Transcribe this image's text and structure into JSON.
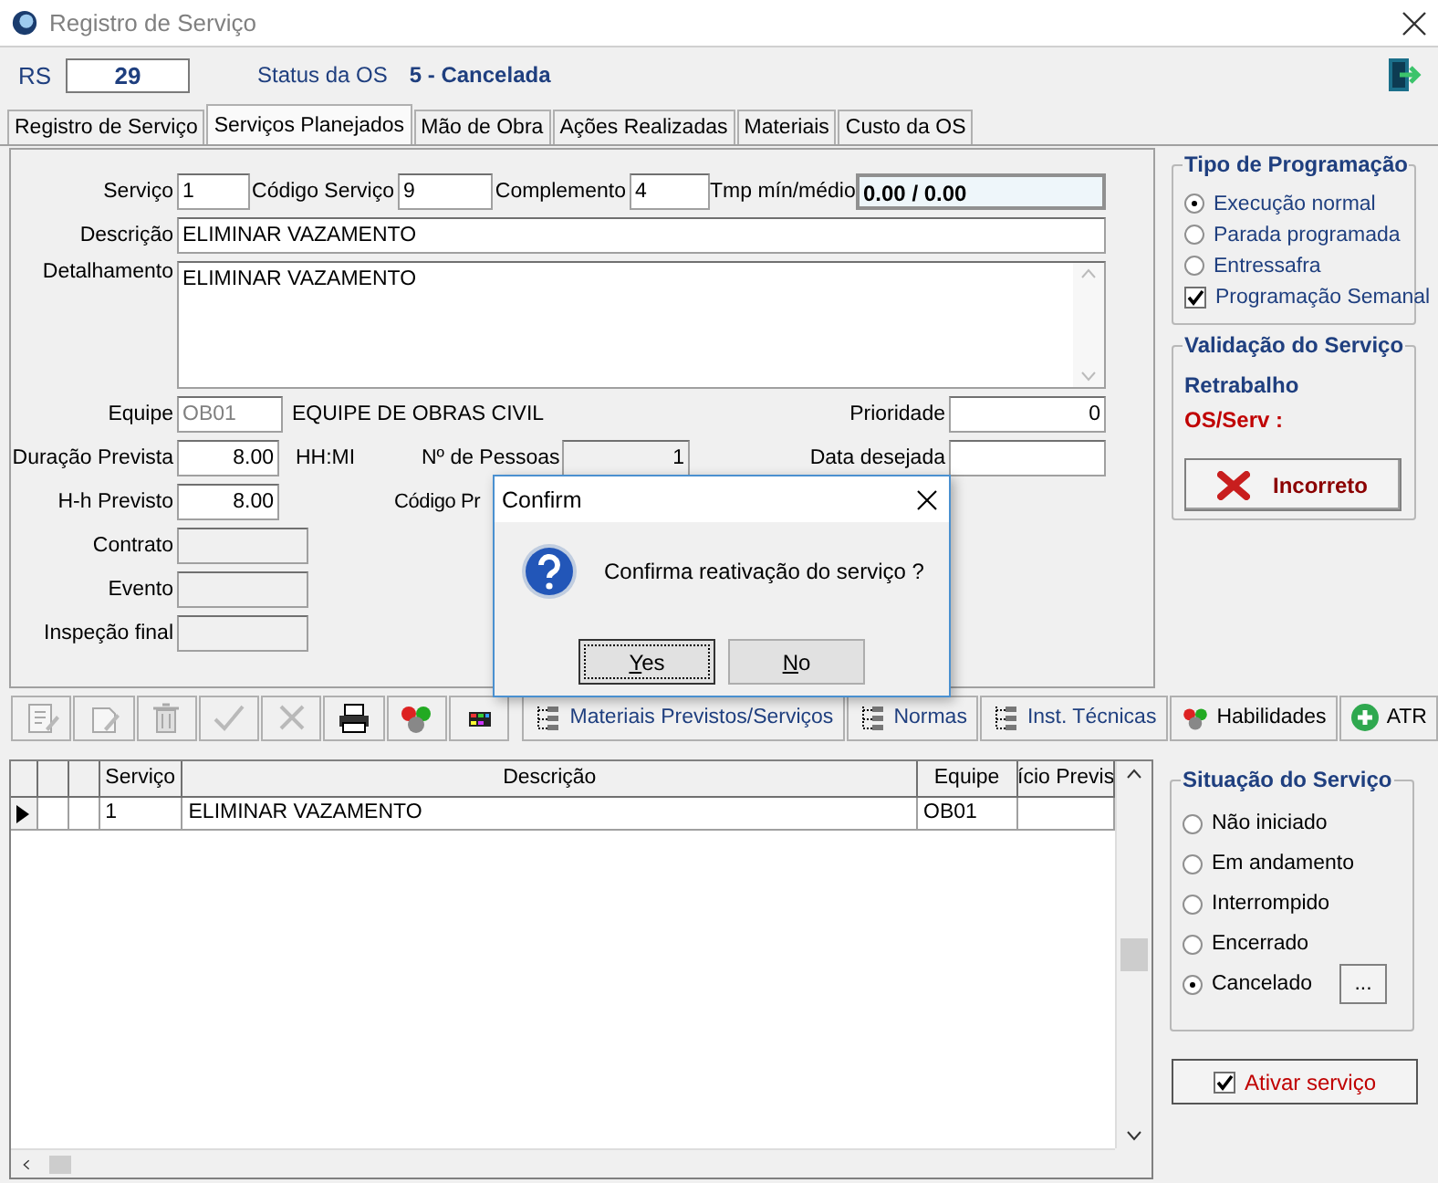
{
  "window": {
    "title": "Registro de Serviço"
  },
  "header": {
    "rs_label": "RS",
    "rs_value": "29",
    "status_label": "Status da OS",
    "status_value": "5 - Cancelada"
  },
  "tabs": [
    {
      "label": "Registro de Serviço",
      "selected": false
    },
    {
      "label": "Serviços Planejados",
      "selected": true
    },
    {
      "label": "Mão de Obra",
      "selected": false
    },
    {
      "label": "Ações Realizadas",
      "selected": false
    },
    {
      "label": "Materiais",
      "selected": false
    },
    {
      "label": "Custo da OS",
      "selected": false
    }
  ],
  "form": {
    "rows": [
      {
        "items": [
          {
            "kind": "label",
            "text": "Serviço"
          },
          {
            "kind": "input",
            "value": "1"
          },
          {
            "kind": "label",
            "text": "Código Serviço"
          },
          {
            "kind": "input",
            "value": "9"
          },
          {
            "kind": "label",
            "text": "Complemento"
          },
          {
            "kind": "input",
            "value": "4"
          },
          {
            "kind": "label",
            "text": "Tmp mín/médio"
          },
          {
            "kind": "readout",
            "value": "0.00 / 0.00"
          }
        ]
      },
      {
        "items": [
          {
            "kind": "label",
            "text": "Descrição"
          },
          {
            "kind": "input",
            "value": "ELIMINAR VAZAMENTO"
          }
        ]
      },
      {
        "items": [
          {
            "kind": "label",
            "text": "Detalhamento"
          },
          {
            "kind": "memo",
            "value": "ELIMINAR VAZAMENTO"
          }
        ]
      },
      {
        "items": [
          {
            "kind": "label",
            "text": "Equipe"
          },
          {
            "kind": "input",
            "value": "OB01",
            "disabled": true
          },
          {
            "kind": "text",
            "text": "EQUIPE DE OBRAS CIVIL"
          },
          {
            "kind": "label",
            "text": "Prioridade"
          },
          {
            "kind": "number",
            "value": "0"
          }
        ]
      },
      {
        "items": [
          {
            "kind": "label",
            "text": "Duração Prevista"
          },
          {
            "kind": "number",
            "value": "8.00"
          },
          {
            "kind": "text",
            "text": "HH:MI"
          },
          {
            "kind": "label",
            "text": "Nº de Pessoas"
          },
          {
            "kind": "number",
            "value": "1",
            "read_only": true
          },
          {
            "kind": "label",
            "text": "Data desejada"
          },
          {
            "kind": "input"
          }
        ]
      },
      {
        "items": [
          {
            "kind": "label",
            "text": "H-h Previsto"
          },
          {
            "kind": "number",
            "value": "8.00"
          },
          {
            "kind": "text",
            "text": "Código Pr"
          }
        ]
      },
      {
        "items": [
          {
            "kind": "label",
            "text": "Contrato"
          },
          {
            "kind": "input",
            "read_only": true
          }
        ]
      },
      {
        "items": [
          {
            "kind": "label",
            "text": "Evento"
          },
          {
            "kind": "input",
            "read_only": true
          }
        ]
      },
      {
        "items": [
          {
            "kind": "label",
            "text": "Inspeção final"
          },
          {
            "kind": "input",
            "read_only": true
          }
        ]
      }
    ]
  },
  "tipo_de_programacao": {
    "title": "Tipo de Programação",
    "options": [
      {
        "kind": "radio",
        "label": "Execução normal",
        "selected": true
      },
      {
        "kind": "radio",
        "label": "Parada programada",
        "selected": false
      },
      {
        "kind": "radio",
        "label": "Entressafra",
        "selected": false
      },
      {
        "kind": "checkbox",
        "label": "Programação Semanal",
        "checked": true
      }
    ]
  },
  "validacao": {
    "title": "Validação do Serviço",
    "retrabalho": "Retrabalho",
    "os_serv": "OS/Serv :",
    "button": "Incorreto"
  },
  "toolbar": {
    "icon_buttons": [
      {
        "kind": "edit-page",
        "disabled": true
      },
      {
        "kind": "edit",
        "disabled": true
      },
      {
        "kind": "trash",
        "disabled": true
      },
      {
        "kind": "check",
        "disabled": true
      },
      {
        "kind": "cross",
        "disabled": true
      },
      {
        "kind": "printer",
        "disabled": false
      },
      {
        "kind": "people",
        "disabled": false
      },
      {
        "kind": "grid",
        "disabled": false
      }
    ],
    "buttons": [
      {
        "kind": "tree",
        "label": "Materiais Previstos/Serviços"
      },
      {
        "kind": "tree",
        "label": "Normas"
      },
      {
        "kind": "tree",
        "label": "Inst. Técnicas"
      },
      {
        "kind": "people",
        "label": "Habilidades"
      },
      {
        "kind": "plus",
        "label": "ATR"
      }
    ]
  },
  "grid": {
    "columns": [
      "Serviço",
      "Descrição",
      "Equipe",
      "ício Previs"
    ],
    "rows": [
      {
        "selected": true,
        "cells": [
          "1",
          "ELIMINAR VAZAMENTO",
          "OB01"
        ]
      }
    ]
  },
  "situacao": {
    "title": "Situação do Serviço",
    "options": [
      {
        "label": "Não iniciado",
        "selected": false
      },
      {
        "label": "Em andamento",
        "selected": false
      },
      {
        "label": "Interrompido",
        "selected": false
      },
      {
        "label": "Encerrado",
        "selected": false
      },
      {
        "label": "Cancelado",
        "selected": true
      }
    ],
    "more_button": "..."
  },
  "ativar": {
    "label": "Ativar serviço",
    "checked": true
  },
  "dialog": {
    "title": "Confirm",
    "message": "Confirma reativação do serviço ?",
    "buttons": [
      {
        "label": "Yes",
        "focused": true
      },
      {
        "label": "No",
        "focused": false
      }
    ]
  }
}
